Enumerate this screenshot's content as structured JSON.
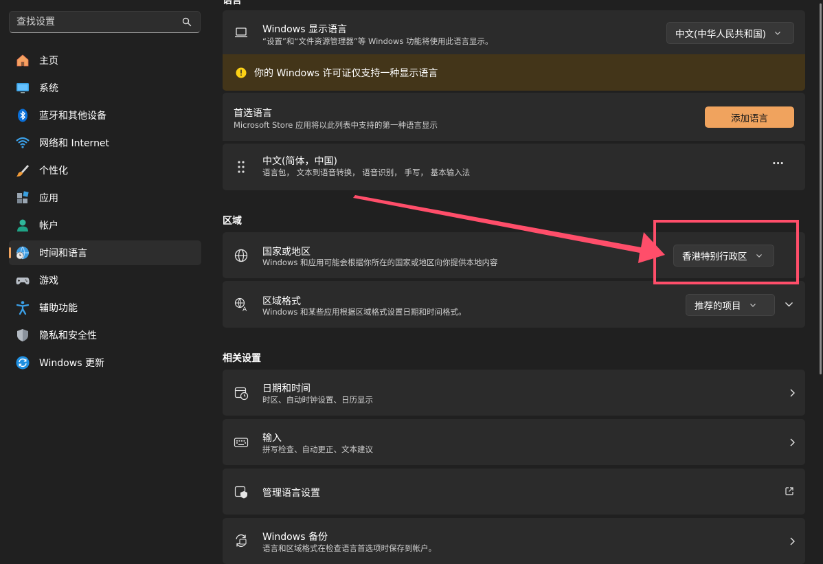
{
  "search": {
    "placeholder": "查找设置"
  },
  "sidebar": {
    "items": [
      {
        "label": "主页",
        "icon": "home-icon"
      },
      {
        "label": "系统",
        "icon": "monitor-icon"
      },
      {
        "label": "蓝牙和其他设备",
        "icon": "bluetooth-icon"
      },
      {
        "label": "网络和 Internet",
        "icon": "wifi-icon"
      },
      {
        "label": "个性化",
        "icon": "brush-icon"
      },
      {
        "label": "应用",
        "icon": "apps-icon"
      },
      {
        "label": "帐户",
        "icon": "person-icon"
      },
      {
        "label": "时间和语言",
        "icon": "globe-clock-icon",
        "active": true
      },
      {
        "label": "游戏",
        "icon": "gamepad-icon"
      },
      {
        "label": "辅助功能",
        "icon": "accessibility-icon"
      },
      {
        "label": "隐私和安全性",
        "icon": "shield-icon"
      },
      {
        "label": "Windows 更新",
        "icon": "sync-icon"
      }
    ]
  },
  "language": {
    "section_title_partial": "语言",
    "display_language": {
      "title": "Windows 显示语言",
      "desc": "“设置”和“文件资源管理器”等 Windows 功能将使用此语言显示。",
      "value": "中文(中华人民共和国)"
    },
    "license_notice": "你的 Windows 许可证仅支持一种显示语言",
    "preferred": {
      "title": "首选语言",
      "desc": "Microsoft Store 应用将以此列表中支持的第一种语言显示",
      "add_button": "添加语言"
    },
    "installed": {
      "title": "中文(简体，中国)",
      "desc": "语言包， 文本到语音转换， 语音识别， 手写， 基本输入法",
      "more": "···"
    }
  },
  "region": {
    "section_title": "区域",
    "country": {
      "title": "国家或地区",
      "desc": "Windows 和应用可能会根据你所在的国家或地区向你提供本地内容",
      "value": "香港特别行政区"
    },
    "format": {
      "title": "区域格式",
      "desc": "Windows 和某些应用根据区域格式设置日期和时间格式。",
      "value": "推荐的项目"
    }
  },
  "related": {
    "section_title": "相关设置",
    "items": [
      {
        "title": "日期和时间",
        "desc": "时区、自动时钟设置、日历显示"
      },
      {
        "title": "输入",
        "desc": "拼写检查、自动更正、文本建议"
      },
      {
        "title": "管理语言设置",
        "desc": ""
      },
      {
        "title": "Windows 备份",
        "desc": "语言和区域格式在检查语言首选项时保存到帐户。"
      }
    ]
  },
  "colors": {
    "accent": "#f0a35e",
    "annotation": "#ff4e6a",
    "notice_bg": "#433519",
    "warning_icon": "#fcd116"
  }
}
